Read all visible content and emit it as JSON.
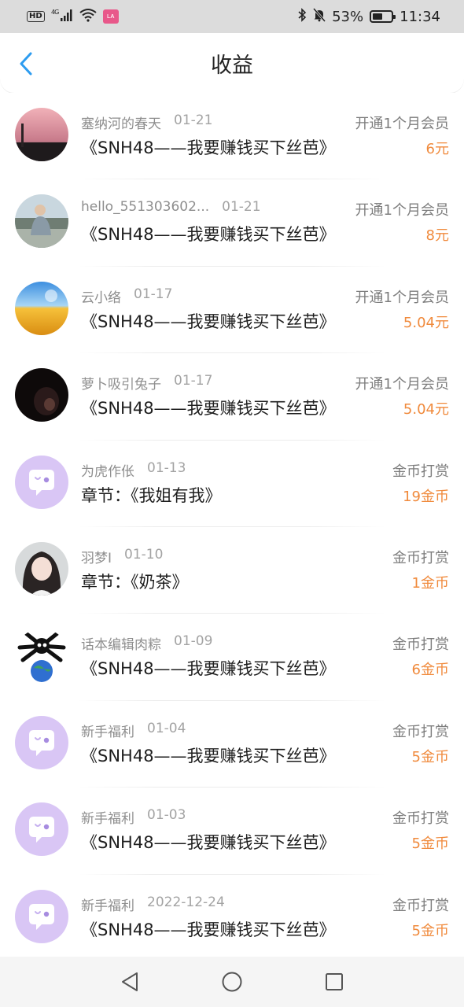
{
  "status_bar": {
    "network": "4G",
    "battery": "53%",
    "battery_level": 0.53,
    "time": "11:34",
    "icons": [
      "hd-icon",
      "signal-icon",
      "wifi-icon",
      "app-notification-icon",
      "bluetooth-icon",
      "mute-icon",
      "battery-icon"
    ]
  },
  "header": {
    "title": "收益",
    "back_icon": "chevron-left-icon"
  },
  "records": [
    {
      "name": "塞纳河的春天",
      "date": "01-21",
      "title": "《SNH48——我要赚钱买下丝芭》",
      "type": "开通1个月会员",
      "amount": "6元",
      "avatar": "photo-pink-sky"
    },
    {
      "name": "hello_551303602...",
      "date": "01-21",
      "title": "《SNH48——我要赚钱买下丝芭》",
      "type": "开通1个月会员",
      "amount": "8元",
      "avatar": "photo-man-sitting"
    },
    {
      "name": "云小络",
      "date": "01-17",
      "title": "《SNH48——我要赚钱买下丝芭》",
      "type": "开通1个月会员",
      "amount": "5.04元",
      "avatar": "photo-wheat-field"
    },
    {
      "name": "萝卜吸引兔子",
      "date": "01-17",
      "title": "《SNH48——我要赚钱买下丝芭》",
      "type": "开通1个月会员",
      "amount": "5.04元",
      "avatar": "photo-dark-portrait"
    },
    {
      "name": "为虎作伥",
      "date": "01-13",
      "title": "章节：《我姐有我》",
      "type": "金币打赏",
      "amount": "19金币",
      "avatar": "default-chat-bubble"
    },
    {
      "name": "羽梦I",
      "date": "01-10",
      "title": "章节：《奶茶》",
      "type": "金币打赏",
      "amount": "1金币",
      "avatar": "photo-girl-portrait"
    },
    {
      "name": "话本编辑肉粽",
      "date": "01-09",
      "title": "《SNH48——我要赚钱买下丝芭》",
      "type": "金币打赏",
      "amount": "6金币",
      "avatar": "photo-cartoon-globe"
    },
    {
      "name": "新手福利",
      "date": "01-04",
      "title": "《SNH48——我要赚钱买下丝芭》",
      "type": "金币打赏",
      "amount": "5金币",
      "avatar": "default-chat-bubble"
    },
    {
      "name": "新手福利",
      "date": "01-03",
      "title": "《SNH48——我要赚钱买下丝芭》",
      "type": "金币打赏",
      "amount": "5金币",
      "avatar": "default-chat-bubble"
    },
    {
      "name": "新手福利",
      "date": "2022-12-24",
      "title": "《SNH48——我要赚钱买下丝芭》",
      "type": "金币打赏",
      "amount": "5金币",
      "avatar": "default-chat-bubble"
    }
  ],
  "colors": {
    "amount": "#f08a3c",
    "back_icon": "#2d9cf0",
    "default_avatar_bg": "#d9c6f5",
    "status_bar_bg": "#dcdcdc",
    "nav_bar_bg": "#f5f5f5"
  },
  "nav_bar": {
    "icons": [
      "back-triangle-icon",
      "home-circle-icon",
      "recents-square-icon"
    ]
  }
}
